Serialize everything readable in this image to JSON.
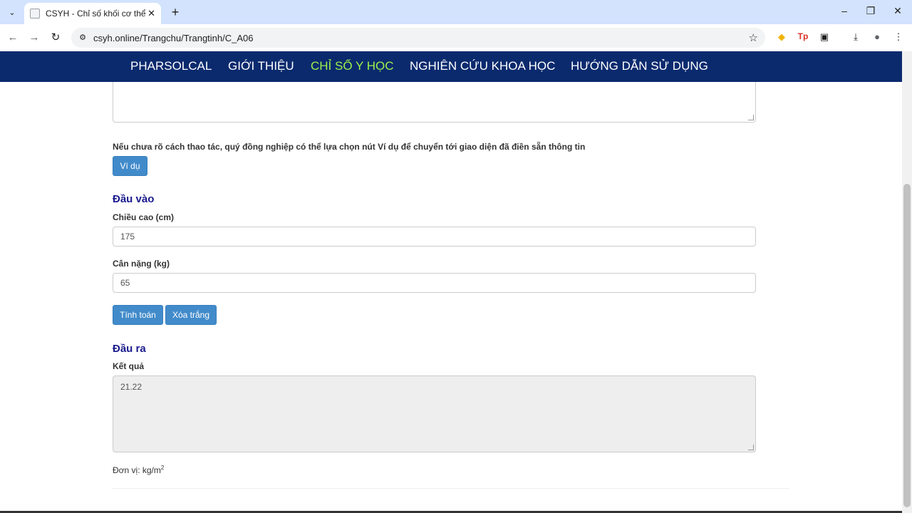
{
  "browser": {
    "tab_title": "CSYH - Chỉ số khối cơ thể (BMI)",
    "url": "csyh.online/Trangchu/Trangtinh/C_A06"
  },
  "nav": {
    "items": [
      {
        "label": "PHARSOLCAL"
      },
      {
        "label": "GIỚI THIỆU"
      },
      {
        "label": "CHỈ SỐ Y HỌC"
      },
      {
        "label": "NGHIÊN CỨU KHOA HỌC"
      },
      {
        "label": "HƯỚNG DẪN SỬ DỤNG"
      }
    ],
    "active_color": "#9cf24b",
    "bg_color": "#0b2a6e"
  },
  "main": {
    "hint": "Nếu chưa rõ cách thao tác, quý đồng nghiệp có thể lựa chọn nút Ví dụ để chuyển tới giao diện đã điền sẵn thông tin",
    "example_button": "Ví dụ",
    "input_section_title": "Đầu vào",
    "height_label": "Chiều cao (cm)",
    "height_value": "175",
    "weight_label": "Cân nặng (kg)",
    "weight_value": "65",
    "calc_button": "Tính toán",
    "clear_button": "Xóa trắng",
    "output_section_title": "Đầu ra",
    "result_label": "Kết quả",
    "result_value": "21.22",
    "unit_text": "Đơn vị: kg/m",
    "unit_sup": "2"
  }
}
